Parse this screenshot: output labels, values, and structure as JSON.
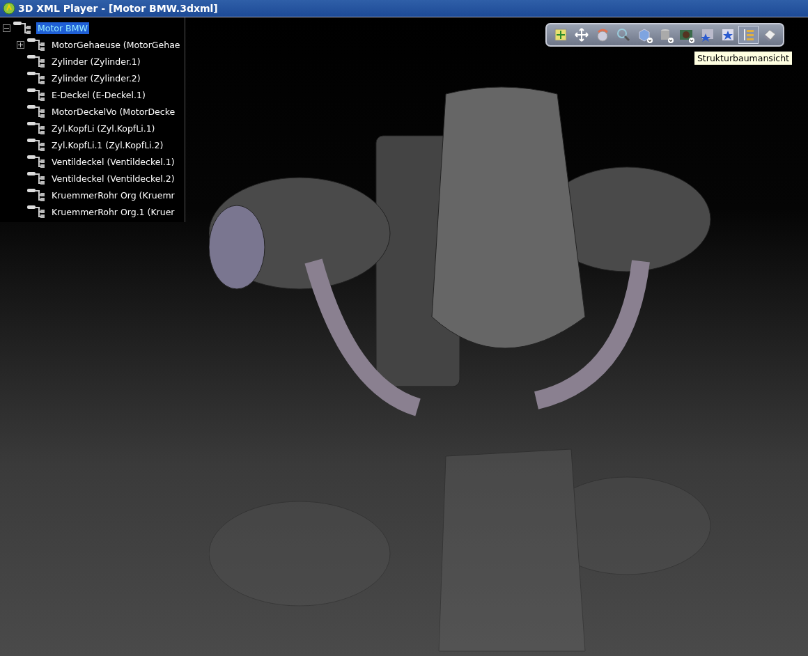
{
  "window": {
    "title": "3D XML Player - [Motor BMW.3dxml]"
  },
  "tree": {
    "label": "Motor BMW",
    "selected": true,
    "expanded": true,
    "children": [
      {
        "label": "MotorGehaeuse (MotorGehae",
        "selected": false,
        "expanded": false
      },
      {
        "label": "Zylinder (Zylinder.1)",
        "selected": false
      },
      {
        "label": "Zylinder (Zylinder.2)",
        "selected": false
      },
      {
        "label": "E-Deckel (E-Deckel.1)",
        "selected": false
      },
      {
        "label": "MotorDeckelVo (MotorDecke",
        "selected": false
      },
      {
        "label": "Zyl.KopfLi (Zyl.KopfLi.1)",
        "selected": false
      },
      {
        "label": "Zyl.KopfLi.1 (Zyl.KopfLi.2)",
        "selected": false
      },
      {
        "label": "Ventildeckel (Ventildeckel.1)",
        "selected": false
      },
      {
        "label": "Ventildeckel (Ventildeckel.2)",
        "selected": false
      },
      {
        "label": "KruemmerRohr Org (Kruemr",
        "selected": false
      },
      {
        "label": "KruemmerRohr Org.1 (Kruer",
        "selected": false
      }
    ]
  },
  "toolbar": {
    "buttons": [
      {
        "selected": false,
        "dropdown": false
      },
      {
        "selected": false,
        "dropdown": false
      },
      {
        "selected": false,
        "dropdown": false
      },
      {
        "selected": false,
        "dropdown": false
      },
      {
        "selected": false,
        "dropdown": true
      },
      {
        "selected": false,
        "dropdown": true
      },
      {
        "selected": false,
        "dropdown": true
      },
      {
        "selected": false,
        "dropdown": false
      },
      {
        "selected": false,
        "dropdown": false
      },
      {
        "selected": true,
        "dropdown": false
      },
      {
        "selected": false,
        "dropdown": false
      }
    ],
    "tooltip": "Strukturbaumansicht"
  }
}
